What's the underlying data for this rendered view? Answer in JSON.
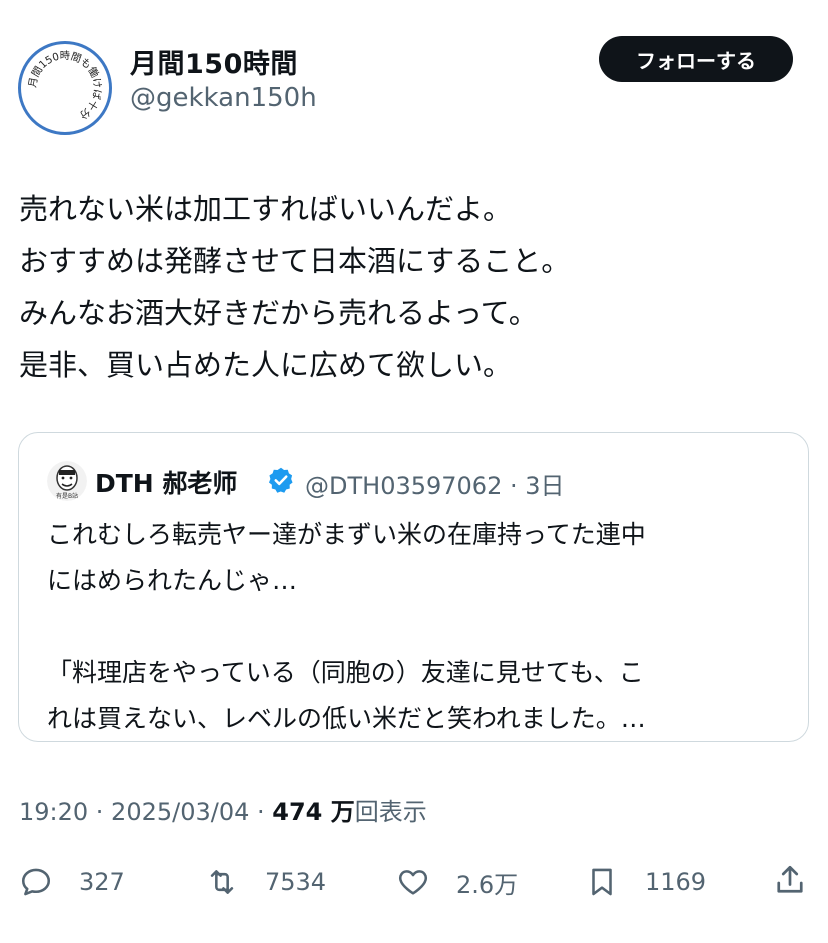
{
  "header": {
    "display_name": "月間150時間",
    "handle": "@gekkan150h",
    "follow_label": "フォローする",
    "avatar_text": "月間150時間も働けば十分"
  },
  "tweet": {
    "lines": [
      "売れない米は加工すればいいんだよ。",
      "おすすめは発酵させて日本酒にすること。",
      "みんなお酒大好きだから売れるよって。",
      "是非、買い占めた人に広めて欲しい。"
    ]
  },
  "quote": {
    "name": "DTH 郝老师",
    "handle_time": "@DTH03597062 · 3日",
    "avatar_caption": "有是B站",
    "lines": [
      "これむしろ転売ヤー達がまずい米の在庫持ってた連中",
      "にはめられたんじゃ…",
      "",
      "「料理店をやっている（同胞の）友達に見せても、こ",
      "れは買えない、レベルの低い米だと笑われました。…"
    ]
  },
  "meta": {
    "time_date": "19:20 · 2025/03/04 · ",
    "views_count": "474 万",
    "views_label": "回表示"
  },
  "actions": {
    "replies": "327",
    "retweets": "7534",
    "likes": "2.6万",
    "bookmarks": "1169"
  },
  "colors": {
    "text": "#0f1419",
    "secondary": "#536471",
    "border": "#cfd9de",
    "verified": "#1d9bf0",
    "avatar_ring": "#3d78c4"
  }
}
